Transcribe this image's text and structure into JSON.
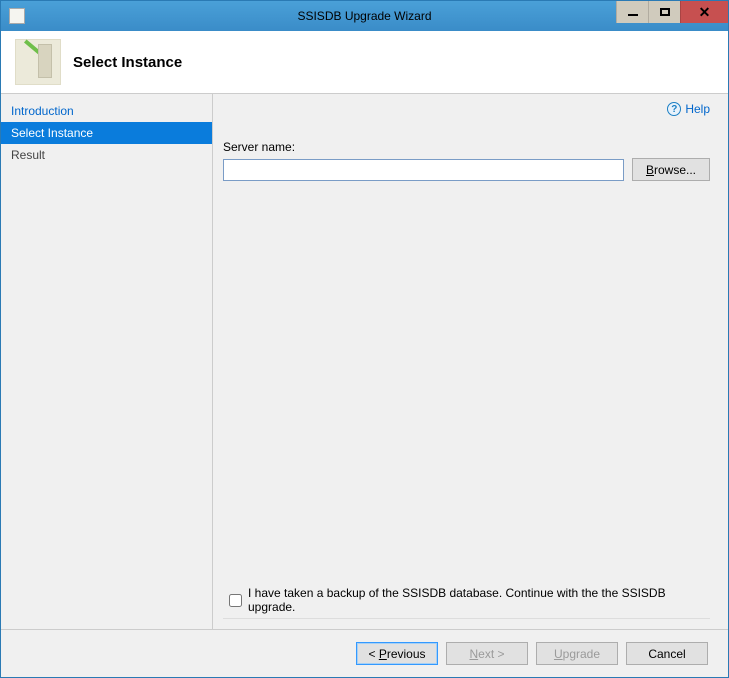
{
  "window": {
    "title": "SSISDB Upgrade Wizard"
  },
  "header": {
    "title": "Select Instance"
  },
  "sidebar": {
    "items": [
      {
        "label": "Introduction",
        "kind": "link"
      },
      {
        "label": "Select Instance",
        "kind": "selected"
      },
      {
        "label": "Result",
        "kind": "normal"
      }
    ]
  },
  "help": {
    "label": "Help"
  },
  "form": {
    "server_name_label": "Server name:",
    "server_name_value": "",
    "browse_label": "Browse...",
    "backup_checkbox_label": "I have taken a backup of the SSISDB database.  Continue with the the SSISDB upgrade.",
    "backup_checked": false
  },
  "footer": {
    "previous": "< Previous",
    "next": "Next >",
    "upgrade": "Upgrade",
    "cancel": "Cancel"
  }
}
